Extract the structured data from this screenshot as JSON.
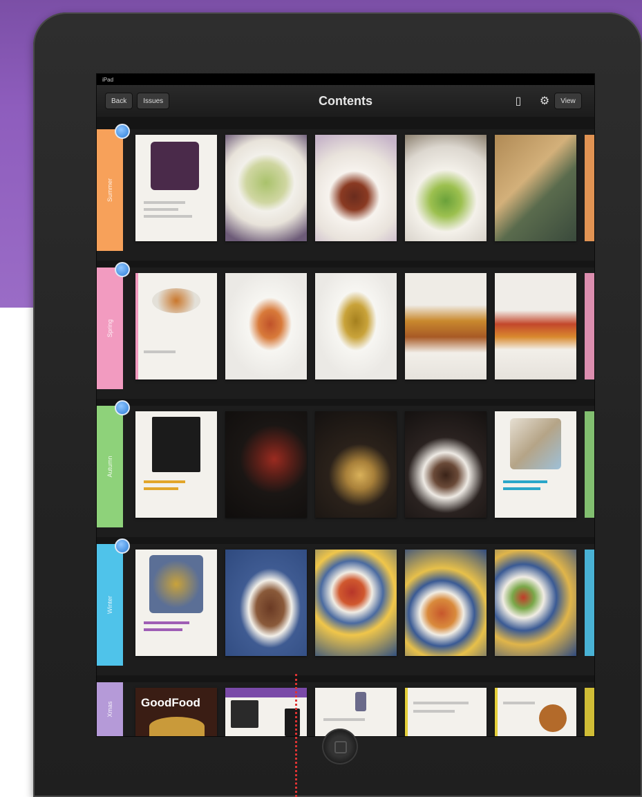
{
  "navbar": {
    "left_button_1": "Back",
    "left_button_2": "Issues",
    "title": "Contents",
    "right_button": "View"
  },
  "status": {
    "carrier": "iPad",
    "time": "",
    "battery": ""
  },
  "sections": [
    {
      "label": "Summer",
      "color": "#f7a15a"
    },
    {
      "label": "Spring",
      "color": "#f29bc0"
    },
    {
      "label": "Autumn",
      "color": "#8ed27a"
    },
    {
      "label": "Winter",
      "color": "#4fc3ea"
    },
    {
      "label": "Xmas",
      "color": "#b59ad8"
    }
  ],
  "magazine_logo": "GoodFood"
}
